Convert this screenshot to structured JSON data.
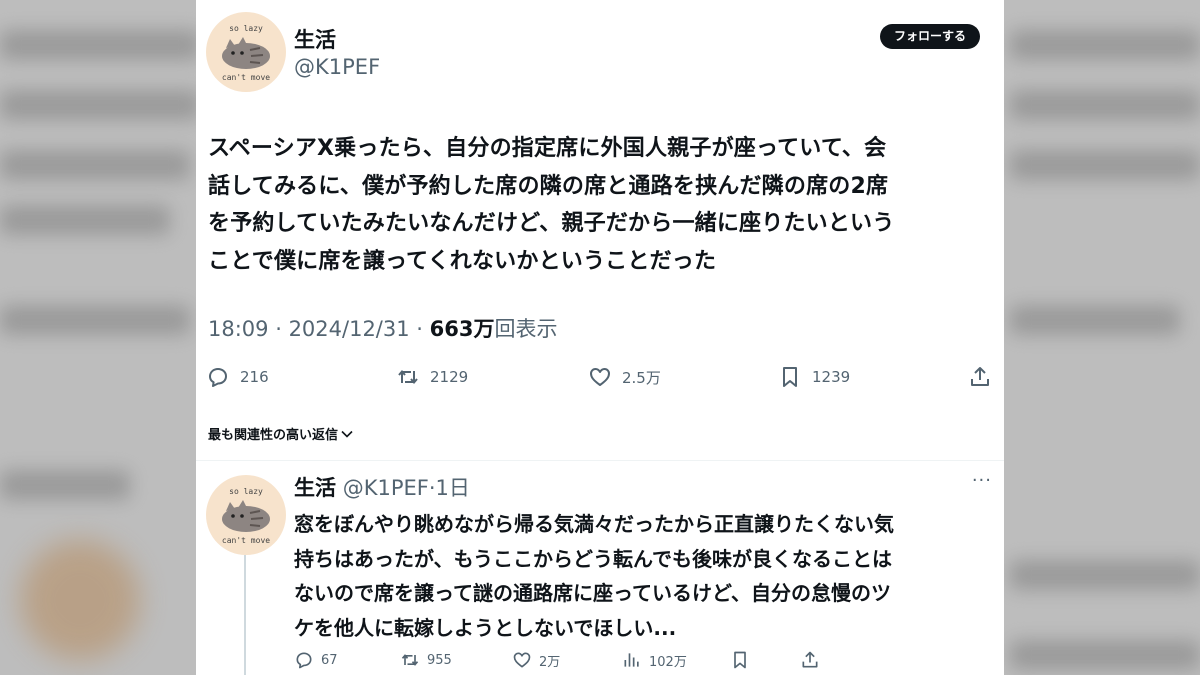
{
  "tweet": {
    "author_name": "生活",
    "author_handle": "@K1PEF",
    "avatar_caption_top": "so lazy",
    "avatar_caption_bottom": "can't move",
    "follow_label": "フォローする",
    "text": "スペーシアX乗ったら、自分の指定席に外国人親子が座っていて、会\n話してみるに、僕が予約した席の隣の席と通路を挟んだ隣の席の2席\nを予約していたみたいなんだけど、親子だから一緒に座りたいという\nことで僕に席を譲ってくれないかということだった",
    "time": "18:09",
    "date": "2024/12/31",
    "separator": " · ",
    "views_count": "663万",
    "views_label": "回表示",
    "replies": "216",
    "retweets": "2129",
    "likes": "2.5万",
    "bookmarks": "1239"
  },
  "sort_label": "最も関連性の高い返信",
  "reply": {
    "author_name": "生活",
    "author_handle": "@K1PEF",
    "age": "·1日",
    "avatar_caption_top": "so lazy",
    "avatar_caption_bottom": "can't move",
    "more": "···",
    "text": "窓をぼんやり眺めながら帰る気満々だったから正直譲りたくない気\n持ちはあったが、もうここからどう転んでも後味が良くなることは\nないので席を譲って謎の通路席に座っているけど、自分の怠慢のツ\nケを他人に転嫁しようとしないでほしい...",
    "replies": "67",
    "retweets": "955",
    "likes": "2万",
    "views": "102万"
  },
  "colors": {
    "text_primary": "#0f1419",
    "text_secondary": "#536471",
    "follow_button_bg": "#0f1419",
    "backdrop": "#bdbdbd"
  },
  "icons": [
    "reply-icon",
    "retweet-icon",
    "like-icon",
    "bookmark-icon",
    "share-icon",
    "views-icon",
    "chevron-down-icon",
    "more-icon"
  ]
}
